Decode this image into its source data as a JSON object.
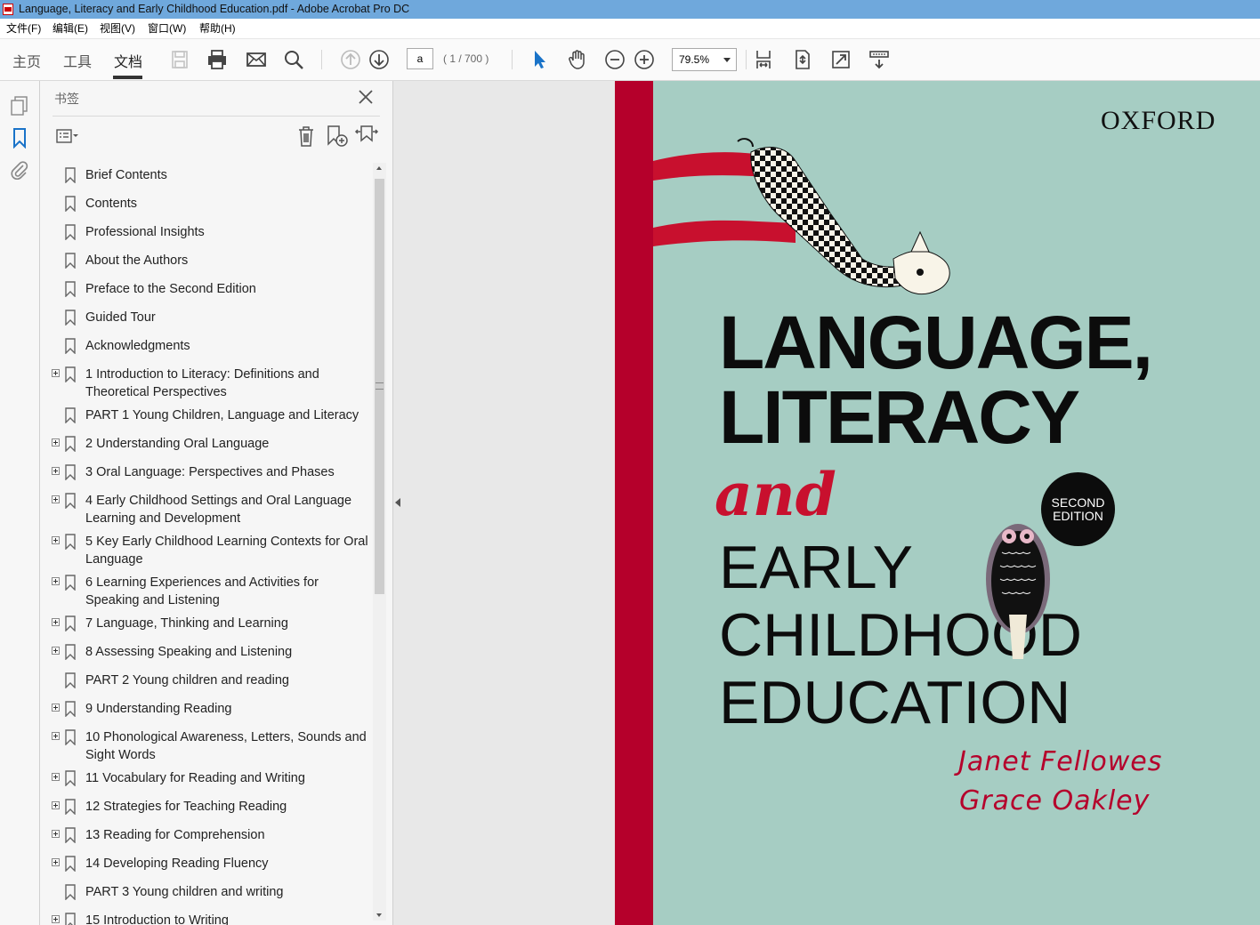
{
  "window": {
    "title": "Language, Literacy and Early Childhood Education.pdf - Adobe Acrobat Pro DC"
  },
  "menu": [
    "文件(F)",
    "编辑(E)",
    "视图(V)",
    "窗口(W)",
    "帮助(H)"
  ],
  "tabs": {
    "home": "主页",
    "tools": "工具",
    "document": "文档"
  },
  "toolbar": {
    "page_value": "a",
    "page_count": "( 1 / 700 )",
    "zoom": "79.5%"
  },
  "icons": {
    "save": "save-icon",
    "print": "print-icon",
    "email": "email-icon",
    "search": "search-icon",
    "prev": "arrow-up-circle-icon",
    "next": "arrow-down-circle-icon",
    "select": "cursor-icon",
    "hand": "hand-icon",
    "zoom_out": "minus-circle-icon",
    "zoom_in": "plus-circle-icon"
  },
  "bookmarks_panel": {
    "title": "书签",
    "items": [
      {
        "label": "Brief Contents",
        "expandable": false
      },
      {
        "label": "Contents",
        "expandable": false
      },
      {
        "label": "Professional Insights",
        "expandable": false
      },
      {
        "label": "About the Authors",
        "expandable": false
      },
      {
        "label": "Preface to the Second Edition",
        "expandable": false
      },
      {
        "label": "Guided Tour",
        "expandable": false
      },
      {
        "label": "Acknowledgments",
        "expandable": false
      },
      {
        "label": "1 Introduction to Literacy: Definitions and Theoretical Perspectives",
        "expandable": true
      },
      {
        "label": "PART 1 Young Children, Language and Literacy",
        "expandable": false
      },
      {
        "label": "2 Understanding Oral Language",
        "expandable": true
      },
      {
        "label": "3 Oral Language: Perspectives and Phases",
        "expandable": true
      },
      {
        "label": "4 Early Childhood Settings and Oral Language Learning and Development",
        "expandable": true
      },
      {
        "label": "5 Key Early Childhood Learning Contexts for Oral Language",
        "expandable": true
      },
      {
        "label": "6 Learning Experiences and Activities for Speaking and Listening",
        "expandable": true
      },
      {
        "label": "7 Language, Thinking and Learning",
        "expandable": true
      },
      {
        "label": "8 Assessing Speaking and Listening",
        "expandable": true
      },
      {
        "label": "PART 2 Young children and reading",
        "expandable": false
      },
      {
        "label": "9 Understanding Reading",
        "expandable": true
      },
      {
        "label": "10 Phonological Awareness, Letters, Sounds and Sight Words",
        "expandable": true
      },
      {
        "label": "11 Vocabulary for Reading and Writing",
        "expandable": true
      },
      {
        "label": "12 Strategies for Teaching Reading",
        "expandable": true
      },
      {
        "label": "13 Reading for Comprehension",
        "expandable": true
      },
      {
        "label": "14 Developing Reading Fluency",
        "expandable": true
      },
      {
        "label": "PART 3 Young children and writing",
        "expandable": false
      },
      {
        "label": "15 Introduction to Writing",
        "expandable": true
      }
    ]
  },
  "cover": {
    "publisher": "OXFORD",
    "title_line1": "LANGUAGE,",
    "title_line2": "LITERACY",
    "title_and": "and",
    "title_line3": "EARLY",
    "title_line4": "CHILDHOOD",
    "title_line5": "EDUCATION",
    "edition_line1": "SECOND",
    "edition_line2": "EDITION",
    "author1": "Janet Fellowes",
    "author2": "Grace Oakley",
    "colors": {
      "background": "#a6cdc3",
      "spine": "#b5002b",
      "accent": "#c8102e"
    }
  }
}
